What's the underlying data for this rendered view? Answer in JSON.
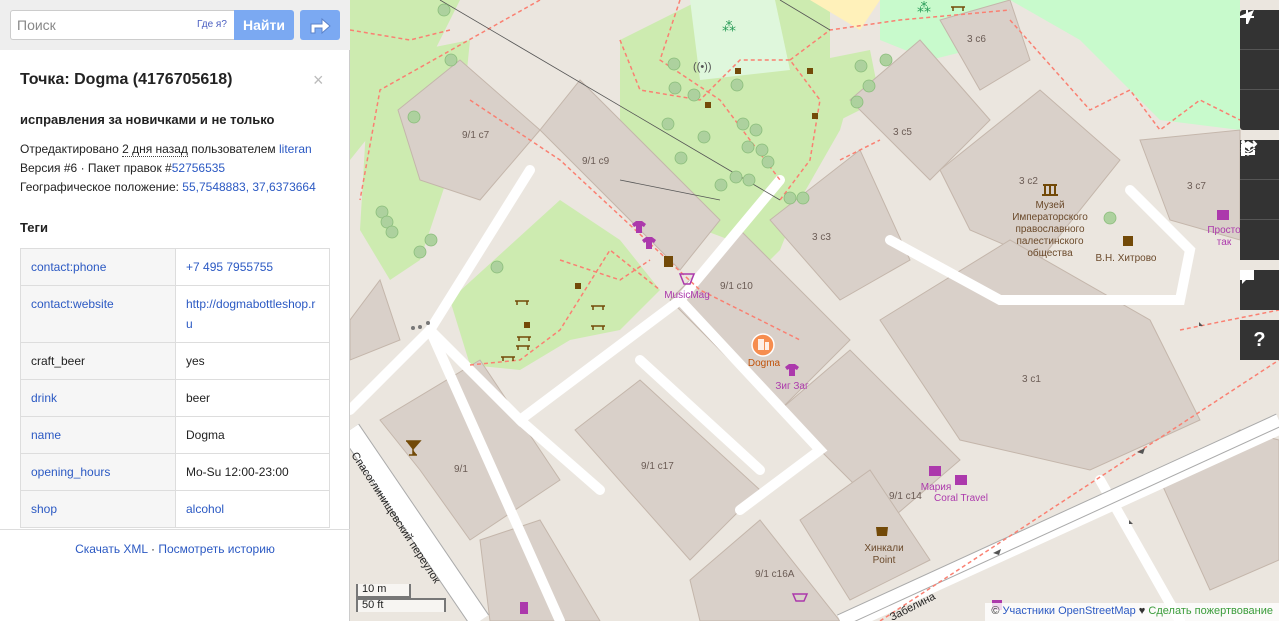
{
  "search": {
    "placeholder": "Поиск",
    "where_am_i": "Где я?",
    "go_label": "Найти"
  },
  "feature": {
    "title": "Точка: Dogma (4176705618)",
    "comment": "исправления за новичками и не только",
    "edited_prefix": "Отредактировано ",
    "edited_ago": "2 дня назад",
    "edited_by": " пользователем ",
    "user": "literan",
    "version_text": "Версия #6 · Пакет правок #",
    "changeset": "52756535",
    "location_label": "Географическое положение: ",
    "location": "55,7548883, 37,6373664"
  },
  "tags": {
    "heading": "Теги",
    "rows": [
      {
        "key": "contact:phone",
        "value": "+7 495 7955755"
      },
      {
        "key": "contact:website",
        "value": "http://dogmabottleshop.ru"
      },
      {
        "key": "craft_beer",
        "value": "yes"
      },
      {
        "key": "drink",
        "value": "beer"
      },
      {
        "key": "name",
        "value": "Dogma"
      },
      {
        "key": "opening_hours",
        "value": "Mo-Su 12:00-23:00"
      },
      {
        "key": "shop",
        "value": "alcohol"
      }
    ]
  },
  "footer": {
    "download_xml": "Скачать XML",
    "separator": " · ",
    "view_history": "Посмотреть историю"
  },
  "map": {
    "labels": {
      "b_9_1_c7": "9/1 с7",
      "b_9_1_c9": "9/1 с9",
      "b_9_1_c10": "9/1 с10",
      "b_9_1": "9/1",
      "b_9_1_c17": "9/1 с17",
      "b_9_1_c14": "9/1 с14",
      "b_9_1_c16a": "9/1 с16А",
      "b_3_c6": "3 с6",
      "b_3_c5": "3 с5",
      "b_3_c3": "3 с3",
      "b_3_c2": "3 с2",
      "b_3_c7": "3 с7",
      "b_3_c1": "3 с1",
      "museum_1": "Музей",
      "museum_2": "Императорского",
      "museum_3": "православного",
      "museum_4": "палестинского",
      "museum_5": "общества",
      "khitrovo": "В.Н. Хитрово",
      "prostotak_1": "Просто",
      "prostotak_2": "так",
      "musicmag": "MusicMag",
      "dogma": "Dogma",
      "zigzag": "Зиг Заг",
      "maria": "Мария",
      "coral": "Coral Travel",
      "khinkali_1": "Хинкали",
      "khinkali_2": "Point",
      "street_spasoglin": "Спасоглинищевский переулок",
      "street_belina": "Забелина"
    },
    "scale_m": "10 m",
    "scale_ft": "50 ft",
    "attribution_copy": "© ",
    "attribution_link": "Участники OpenStreetMap",
    "attribution_heart": " ♥ ",
    "attribution_donate": "Сделать пожертвование",
    "colors": {
      "building": "#d9d0c9",
      "park": "#c8facc",
      "grass": "#cdebb0",
      "road": "#ffffff",
      "footway": "#fa8072",
      "poi": "#ac39ac",
      "dogma_marker": "#f68d4f"
    }
  },
  "controls": {
    "icons": [
      "zoom-in-icon",
      "zoom-out-icon",
      "locate-icon",
      "layers-icon",
      "info-icon",
      "share-icon",
      "note-icon",
      "help-icon"
    ]
  }
}
